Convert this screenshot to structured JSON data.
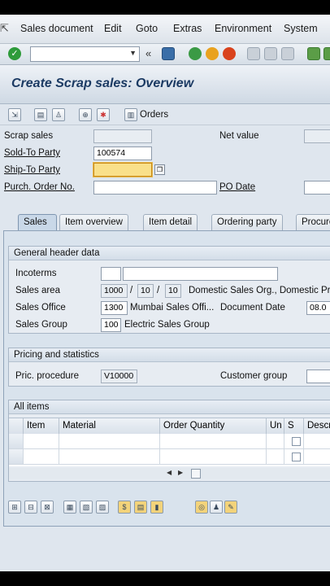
{
  "menu": {
    "items": [
      "Sales document",
      "Edit",
      "Goto",
      "Extras",
      "Environment",
      "System"
    ]
  },
  "toolbar": {
    "command_field_value": ""
  },
  "title": "Create Scrap sales: Overview",
  "app_toolbar": {
    "orders_label": "Orders"
  },
  "header": {
    "scrap_sales_label": "Scrap sales",
    "scrap_sales_value": "",
    "net_value_label": "Net value",
    "net_value_value": "",
    "sold_to_label": "Sold-To Party",
    "sold_to_value": "100574",
    "ship_to_label": "Ship-To Party",
    "ship_to_value": "",
    "purch_order_label": "Purch. Order No.",
    "purch_order_value": "",
    "po_date_label": "PO Date",
    "po_date_value": ""
  },
  "tabs": [
    "Sales",
    "Item overview",
    "Item detail",
    "Ordering party",
    "Procure"
  ],
  "general_header": {
    "title": "General header data",
    "incoterms_label": "Incoterms",
    "incoterms_value1": "",
    "incoterms_value2": "",
    "sales_area_label": "Sales area",
    "sales_org": "1000",
    "dist_channel": "10",
    "division": "10",
    "sep": "/",
    "sales_area_desc": "Domestic Sales Org., Domestic Pr",
    "sales_office_label": "Sales Office",
    "sales_office_value": "1300",
    "sales_office_desc": "Mumbai Sales Offi...",
    "doc_date_label": "Document Date",
    "doc_date_value": "08.0",
    "sales_group_label": "Sales Group",
    "sales_group_value": "100",
    "sales_group_desc": "Electric Sales Group"
  },
  "pricing": {
    "title": "Pricing and statistics",
    "proc_label": "Pric. procedure",
    "proc_value": "V10000",
    "cust_group_label": "Customer group",
    "cust_group_value": ""
  },
  "items": {
    "title": "All items",
    "columns": [
      "Item",
      "Material",
      "Order Quantity",
      "Un",
      "S",
      "Descr"
    ]
  },
  "colors": {
    "title_text": "#1b3a63",
    "background": "#dfe6ee",
    "focus_field": "#f9e08a"
  }
}
